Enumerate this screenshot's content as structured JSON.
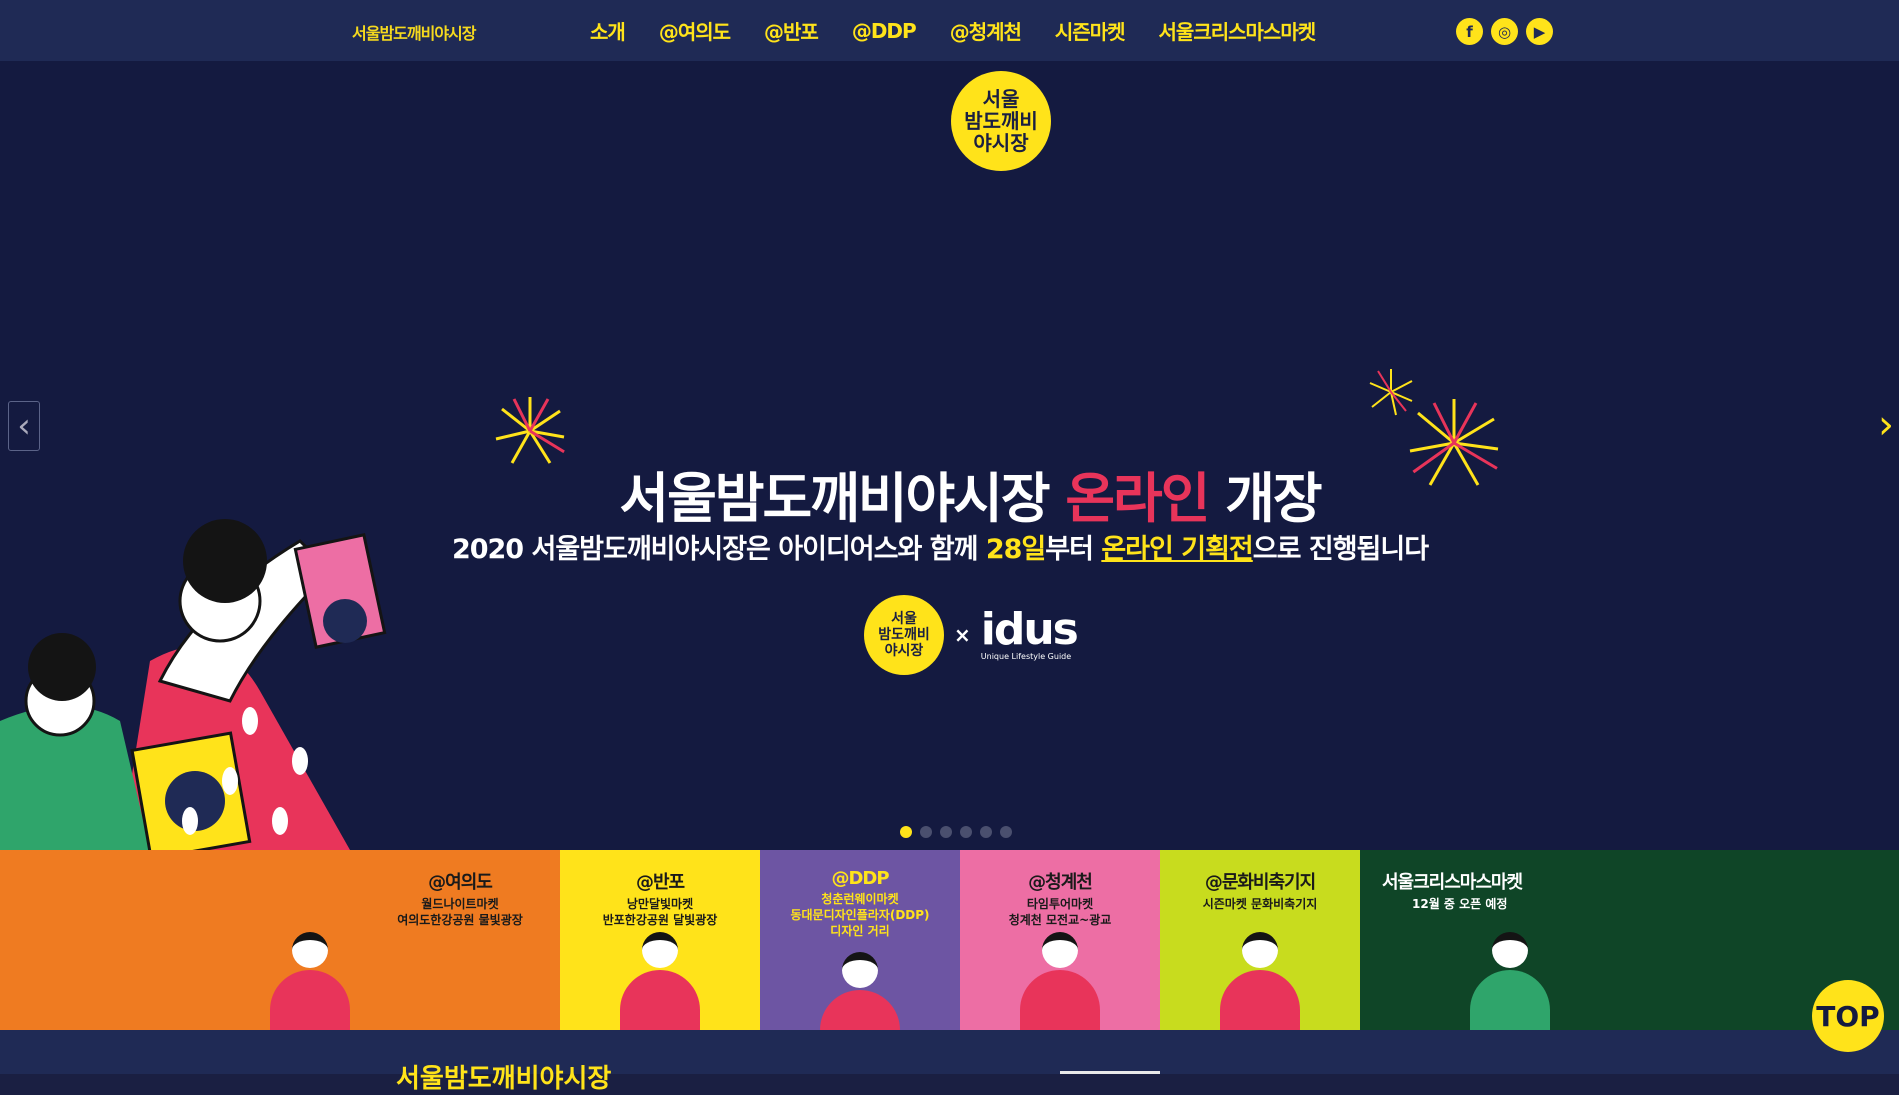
{
  "nav": {
    "logo": "서울밤도깨비야시장",
    "items": [
      "소개",
      "@여의도",
      "@반포",
      "@DDP",
      "@청계천",
      "시즌마켓",
      "서울크리스마스마켓"
    ],
    "social": [
      "f",
      "◎",
      "▶"
    ]
  },
  "hero": {
    "logo_text": "서울\n밤도깨비\n야시장",
    "headline_main": "서울밤도깨비야시장 ",
    "headline_red": "온라인",
    "headline_end": " 개장",
    "sub_1": "2020 서울밤도깨비야시장은 아이디어스와 함께 ",
    "sub_date": "28일",
    "sub_2": "부터 ",
    "sub_online": "온라인 기획전",
    "sub_3": "으로 진행됩니다",
    "badge": "서울\n밤도깨비\n야시장",
    "times": "×",
    "partner": "idus",
    "partner_tag": "Unique Lifestyle Guide",
    "prev": "‹",
    "next": "›"
  },
  "tiles": [
    {
      "title": "@여의도",
      "sub": "월드나이트마켓\n여의도한강공원 물빛광장",
      "bg": "#ef7b21",
      "fg": "#1a1a1a"
    },
    {
      "title": "@반포",
      "sub": "낭만달빛마켓\n반포한강공원 달빛광장",
      "bg": "#ffe31a",
      "fg": "#1a1a1a"
    },
    {
      "title": "@DDP",
      "sub": "청춘런웨이마켓\n동대문디자인플라자(DDP)\n디자인 거리",
      "bg": "#6d55a3",
      "fg": "#ffe31a"
    },
    {
      "title": "@청계천",
      "sub": "타임투어마켓\n청계천 모전교~광교",
      "bg": "#ed6ea4",
      "fg": "#1a1a1a"
    },
    {
      "title": "@문화비축기지",
      "sub": "시즌마켓 문화비축기지",
      "bg": "#c8dc1e",
      "fg": "#1a1a1a"
    },
    {
      "title": "서울크리스마스마켓",
      "sub": "12월 중 오픈 예정",
      "bg": "#0f4527",
      "fg": "#ffffff"
    }
  ],
  "bottom": {
    "title": "서울밤도깨비야시장"
  },
  "top_button": "TOP",
  "colors": {
    "navy": "#1f2a55",
    "yellow": "#ffe31a",
    "red": "#e8345a"
  }
}
